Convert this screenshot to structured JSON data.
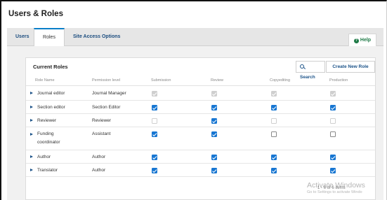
{
  "page": {
    "title": "Users & Roles"
  },
  "tabs": [
    {
      "label": "Users",
      "active": false
    },
    {
      "label": "Roles",
      "active": true
    },
    {
      "label": "Site Access Options",
      "active": false
    }
  ],
  "help": {
    "icon": "help-circle-icon",
    "glyph": "?",
    "label": "Help"
  },
  "panel": {
    "title": "Current Roles",
    "search_label": "Search",
    "search_icon": "search-icon",
    "create_label": "Create New Role"
  },
  "table": {
    "columns": [
      "Role Name",
      "Permission level",
      "Submission",
      "Review",
      "Copyediting",
      "Production"
    ],
    "rows": [
      {
        "name": "Journal editor",
        "level": "Journal Manager",
        "submission": "checked-disabled",
        "review": "checked-disabled",
        "copyediting": "checked-disabled",
        "production": "checked-disabled"
      },
      {
        "name": "Section editor",
        "level": "Section Editor",
        "submission": "checked",
        "review": "checked",
        "copyediting": "checked",
        "production": "checked"
      },
      {
        "name": "Reviewer",
        "level": "Reviewer",
        "submission": "unchecked-disabled",
        "review": "checked",
        "copyediting": "unchecked-disabled",
        "production": "unchecked-disabled"
      },
      {
        "name": "Funding coordinator",
        "name_line1": "Funding",
        "name_line2": "coordinator",
        "level": "Assistant",
        "submission": "checked",
        "review": "checked",
        "copyediting": "unchecked",
        "production": "unchecked"
      },
      {
        "name": "Author",
        "level": "Author",
        "submission": "checked",
        "review": "checked",
        "copyediting": "checked",
        "production": "checked"
      },
      {
        "name": "Translator",
        "level": "Author",
        "submission": "checked",
        "review": "checked",
        "copyediting": "checked",
        "production": "checked"
      }
    ]
  },
  "pager": {
    "text": "1 - 6 of 6 items"
  },
  "watermark": {
    "line1": "Activate Windows",
    "line2": "Go to Settings to activate Windo"
  },
  "colors": {
    "accent": "#1776d2",
    "link": "#1b5288",
    "help": "#1e7a46",
    "tab_indicator": "#0a7fc8"
  }
}
